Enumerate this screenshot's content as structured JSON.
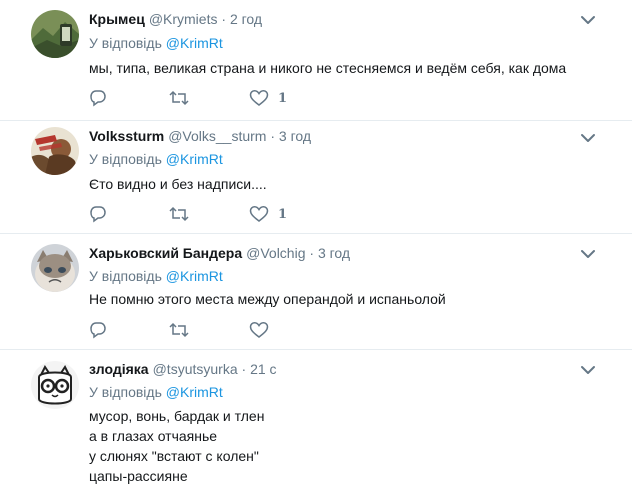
{
  "tweets": [
    {
      "name": "Крымец",
      "handle": "@Krymiets",
      "time": "2 год",
      "reply_prefix": "У відповідь",
      "reply_to": "@KrimRt",
      "lines": [
        "мы, типа, великая страна и никого не стесняемся и ведём себя, как дома"
      ],
      "likes": "1"
    },
    {
      "name": "Volkssturm",
      "handle": "@Volks__sturm",
      "time": "3 год",
      "reply_prefix": "У відповідь",
      "reply_to": "@KrimRt",
      "lines": [
        "Єто видно и без надписи...."
      ],
      "likes": "1"
    },
    {
      "name": "Харьковский Бандера",
      "handle": "@Volchig",
      "time": "3 год",
      "reply_prefix": "У відповідь",
      "reply_to": "@KrimRt",
      "lines": [
        "Не помню этого места между операндой и испаньолой"
      ],
      "likes": ""
    },
    {
      "name": "злодіяка",
      "handle": "@tsyutsyurka",
      "time": "21 с",
      "reply_prefix": "У відповідь",
      "reply_to": "@KrimRt",
      "lines": [
        "мусор, вонь, бардак и тлен",
        "а в глазах отчаянье",
        "у слюнях \"встают с колен\"",
        "цапы-рассияне"
      ],
      "likes": ""
    }
  ],
  "colors": {
    "text": "#14171a",
    "muted": "#657786",
    "link": "#1b95e0",
    "divider": "#e6ecf0"
  },
  "icons": {
    "more": "chevron-down-icon",
    "reply": "reply-icon",
    "retweet": "retweet-icon",
    "like": "heart-icon"
  }
}
